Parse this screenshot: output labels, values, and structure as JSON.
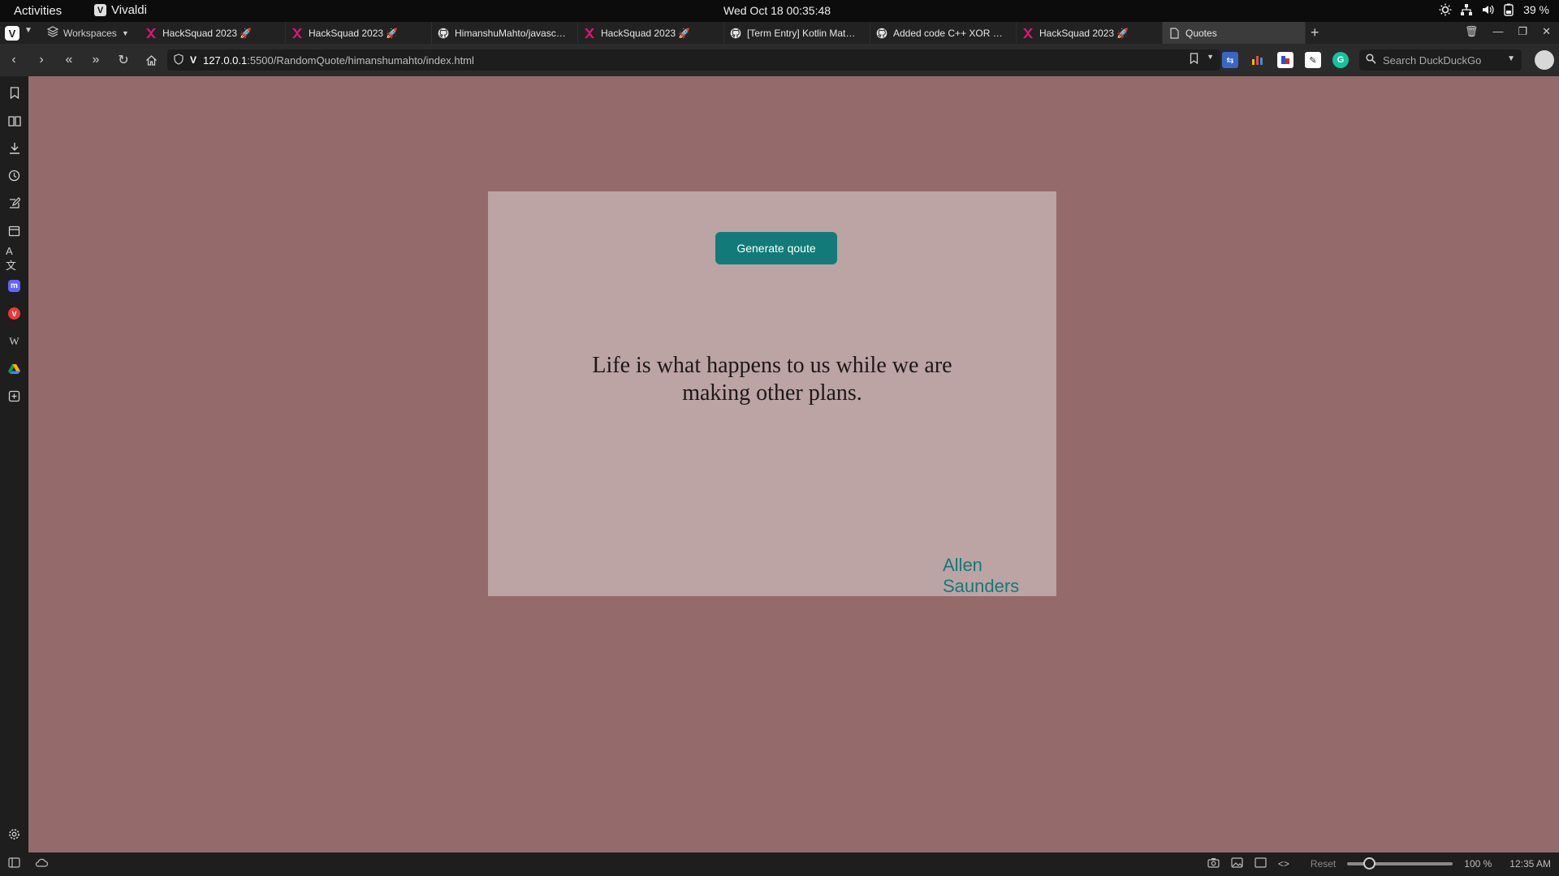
{
  "gnome": {
    "activities": "Activities",
    "app_name": "Vivaldi",
    "clock": "Wed Oct 18  00:35:48",
    "battery": "39 %"
  },
  "browser": {
    "workspaces_label": "Workspaces",
    "tabs": [
      {
        "title": "HackSquad 2023 🚀",
        "favicon": "hacksquad-icon",
        "active": false
      },
      {
        "title": "HackSquad 2023 🚀",
        "favicon": "hacksquad-icon",
        "active": false
      },
      {
        "title": "HimanshuMahto/javascri...",
        "favicon": "github-icon",
        "active": false
      },
      {
        "title": "HackSquad 2023 🚀",
        "favicon": "hacksquad-icon",
        "active": false
      },
      {
        "title": "[Term Entry] Kotlin Math ...",
        "favicon": "github-icon",
        "active": false
      },
      {
        "title": "Added code C++ XOR by...",
        "favicon": "github-icon",
        "active": false
      },
      {
        "title": "HackSquad 2023 🚀",
        "favicon": "hacksquad-icon",
        "active": false
      },
      {
        "title": "Quotes",
        "favicon": "page-icon",
        "active": true
      }
    ],
    "url_host": "127.0.0.1",
    "url_path": ":5500/RandomQuote/himanshumahto/index.html",
    "search_placeholder": "Search DuckDuckGo"
  },
  "page": {
    "button_label": "Generate qoute",
    "quote": "Life is what happens to us while we are making other plans.",
    "author": "Allen Saunders",
    "colors": {
      "background": "#956a6a",
      "card": "#bca3a4",
      "button": "#127b79",
      "author": "#137a7a"
    }
  },
  "status": {
    "reset_label": "Reset",
    "zoom": "100 %",
    "time": "12:35 AM"
  }
}
